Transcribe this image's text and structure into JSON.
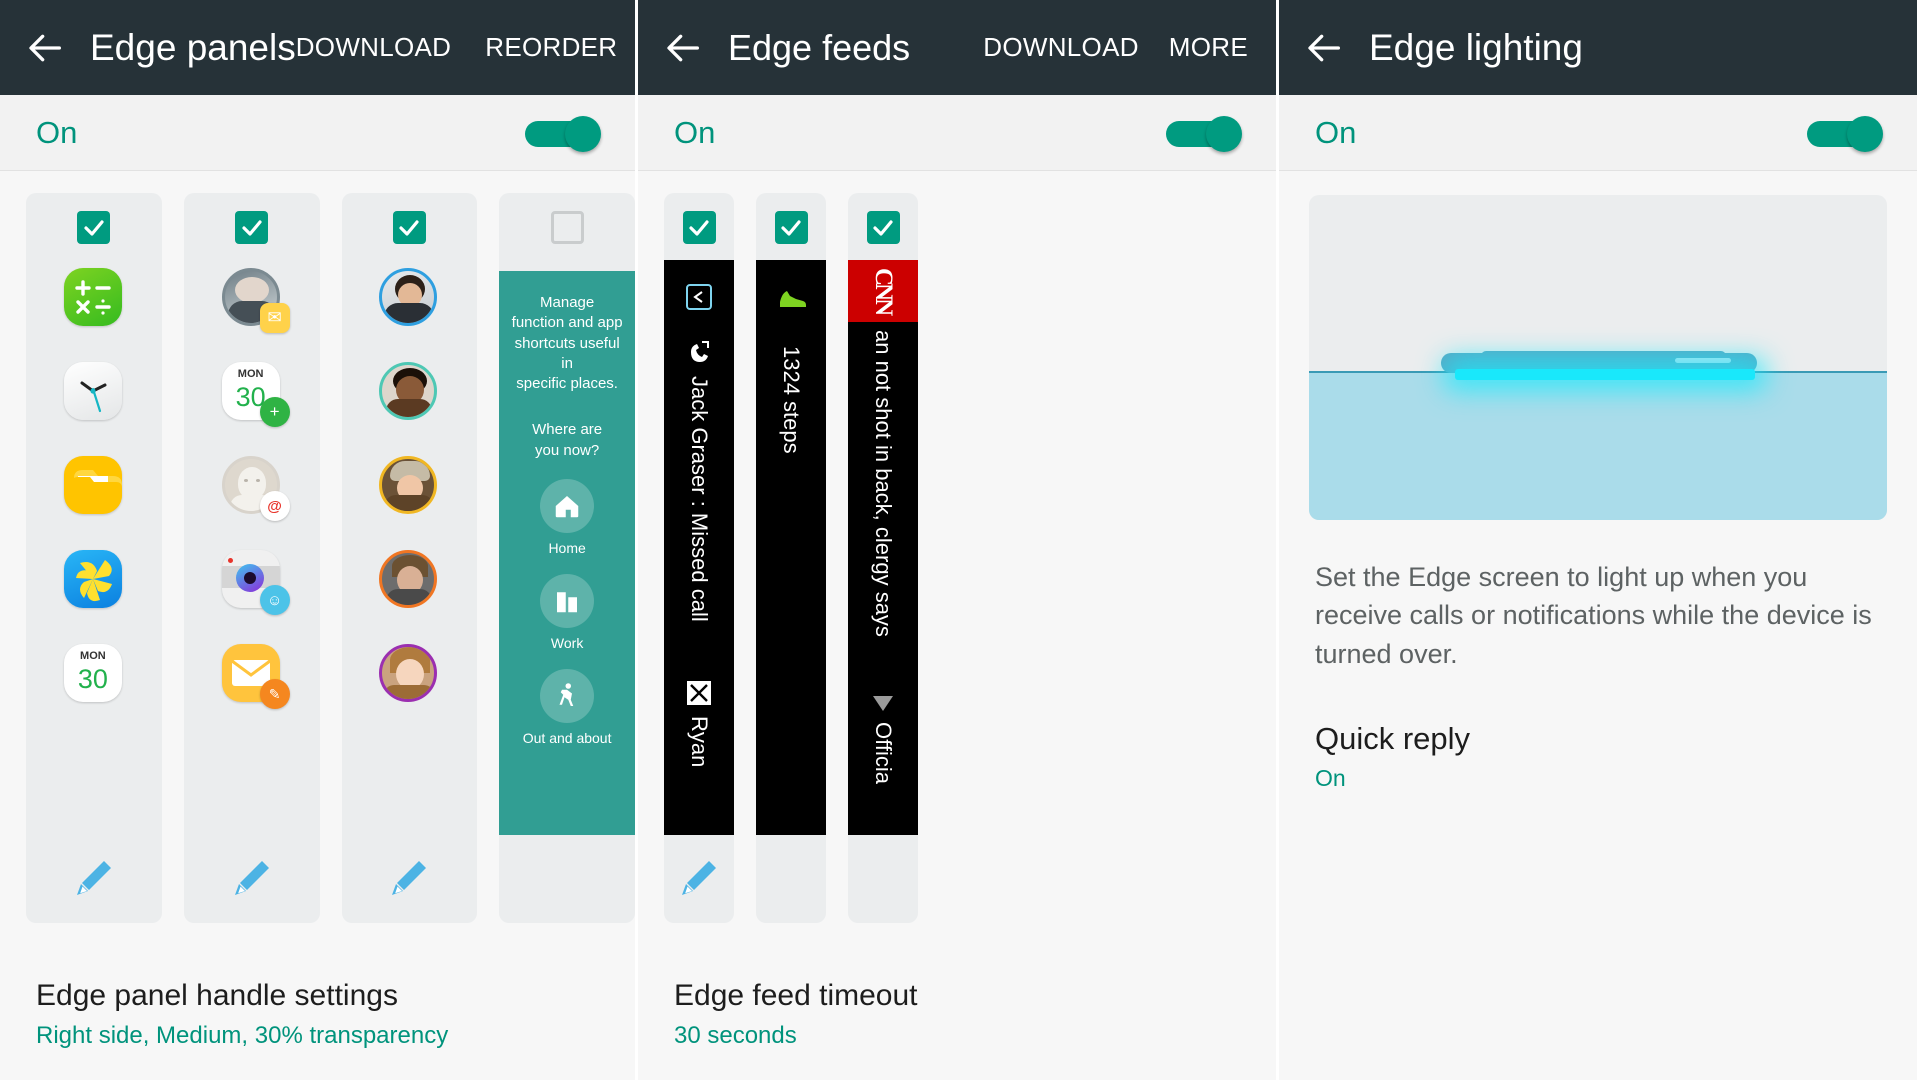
{
  "screens": [
    {
      "title": "Edge panels",
      "actions": [
        "DOWNLOAD",
        "REORDER"
      ],
      "master_state": "On",
      "panels": [
        {
          "checked": true,
          "icons": [
            "calculator",
            "clock",
            "my-files",
            "gallery",
            "calendar-30"
          ]
        },
        {
          "checked": true,
          "icons": [
            "contact-message",
            "calendar-add",
            "contact-email",
            "camera-sticker",
            "email-compose"
          ]
        },
        {
          "checked": true,
          "icons": [
            "contact-blue",
            "contact-teal",
            "contact-yellow",
            "contact-orange",
            "contact-purple"
          ]
        },
        {
          "checked": false,
          "promo": {
            "line1": "Manage",
            "line2": "function and app",
            "line3": "shortcuts useful in",
            "line4": "specific places.",
            "question1": "Where are",
            "question2": "you now?",
            "places": [
              "Home",
              "Work",
              "Out and about"
            ]
          }
        }
      ],
      "bottom": {
        "title": "Edge panel handle settings",
        "subtitle": "Right side, Medium, 30% transparency"
      }
    },
    {
      "title": "Edge feeds",
      "actions": [
        "DOWNLOAD",
        "MORE"
      ],
      "master_state": "On",
      "feeds": [
        {
          "checked": true,
          "kind": "notifications",
          "line1": "Jack Graser : Missed call",
          "line2": "Ryan"
        },
        {
          "checked": true,
          "kind": "steps",
          "line1": "1324 steps"
        },
        {
          "checked": true,
          "kind": "cnn",
          "brand": "CNN",
          "line1": "an not shot in back, clergy says",
          "line2": "Officia"
        }
      ],
      "bottom": {
        "title": "Edge feed timeout",
        "subtitle": "30 seconds"
      }
    },
    {
      "title": "Edge lighting",
      "actions": [],
      "master_state": "On",
      "description": "Set the Edge screen to light up when you receive calls or notifications while the device is turned over.",
      "item": {
        "title": "Quick reply",
        "subtitle": "On"
      }
    }
  ],
  "colors": {
    "appbar": "#263238",
    "accent_teal": "#00937c",
    "toggle_on": "#009b80",
    "promo_bg": "#319e93",
    "edge_glow": "#19e8fb",
    "cnn_red": "#cc0000",
    "pencil_blue": "#4cb3e4"
  }
}
